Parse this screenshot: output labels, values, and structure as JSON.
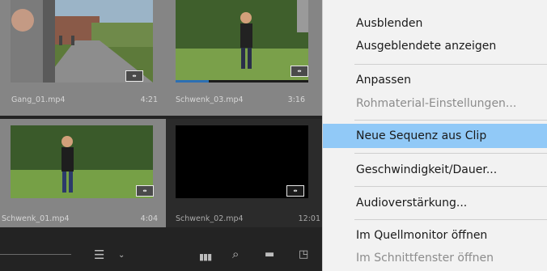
{
  "clips": [
    {
      "name": "Gang_01.mp4",
      "duration": "4:21",
      "selected": true
    },
    {
      "name": "Schwenk_03.mp4",
      "duration": "3:16",
      "selected": true,
      "playhead": 0.25
    },
    {
      "name": "Schwenk_01.mp4",
      "duration": "4:04",
      "selected": true
    },
    {
      "name": "Schwenk_02.mp4",
      "duration": "12:01",
      "selected": false
    }
  ],
  "badge_symbol": "⇹",
  "toolbar": {
    "icons": [
      "list-view-icon",
      "chevron-down-icon",
      "automate-to-sequence-icon",
      "search-icon",
      "new-bin-icon",
      "new-item-icon"
    ]
  },
  "context_menu": {
    "items": [
      {
        "label": "Ausblenden",
        "enabled": true,
        "highlighted": false
      },
      {
        "label": "Ausgeblendete anzeigen",
        "enabled": true,
        "highlighted": false
      },
      {
        "label": "Anpassen",
        "enabled": true,
        "highlighted": false
      },
      {
        "label": "Rohmaterial-Einstellungen...",
        "enabled": false,
        "highlighted": false
      },
      {
        "label": "Neue Sequenz aus Clip",
        "enabled": true,
        "highlighted": true
      },
      {
        "label": "Geschwindigkeit/Dauer...",
        "enabled": true,
        "highlighted": false
      },
      {
        "label": "Audioverstärkung...",
        "enabled": true,
        "highlighted": false
      },
      {
        "label": "Im Quellmonitor öffnen",
        "enabled": true,
        "highlighted": false
      },
      {
        "label": "Im Schnittfenster öffnen",
        "enabled": false,
        "highlighted": false
      }
    ]
  },
  "colors": {
    "highlight": "#91c9f7",
    "selected_tile": "#858585",
    "playhead": "#2d6fb3"
  }
}
